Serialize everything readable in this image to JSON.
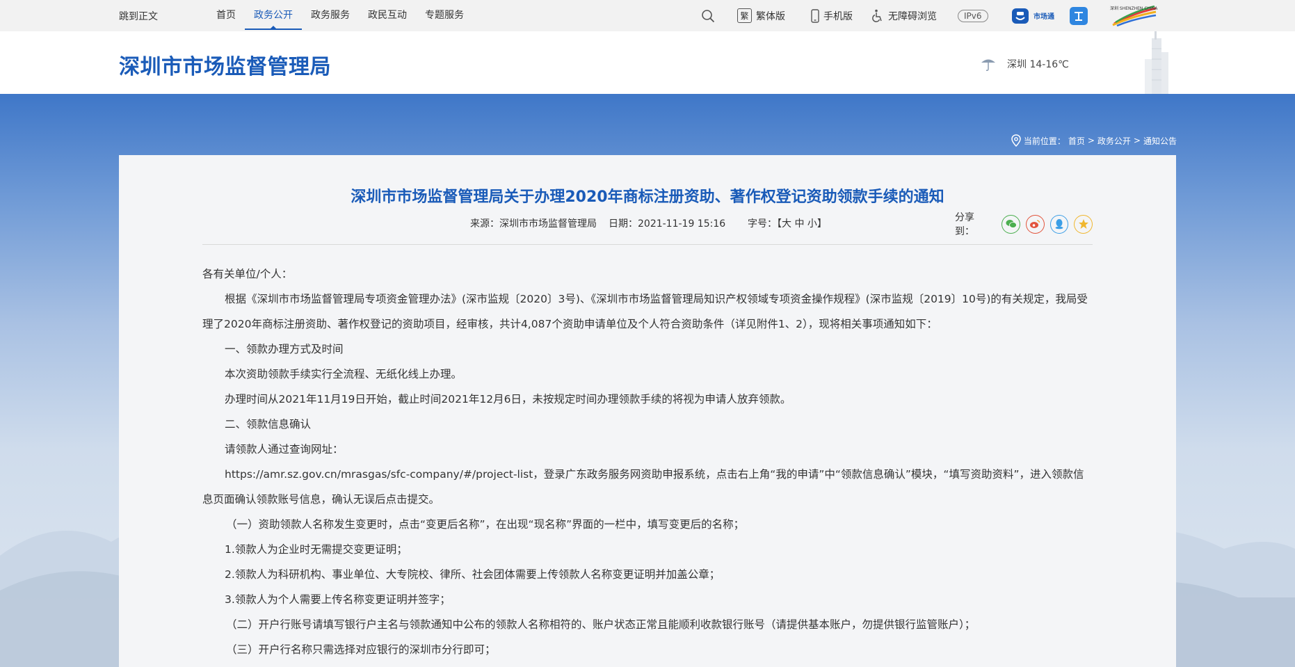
{
  "topbar": {
    "skip": "跳到正文",
    "nav": [
      "首页",
      "政务公开",
      "政务服务",
      "政民互动",
      "专题服务"
    ],
    "active_index": 1,
    "traditional": "繁体版",
    "traditional_glyph": "繁",
    "mobile": "手机版",
    "accessibility": "无障碍浏览",
    "ipv6": "IPv6",
    "shitong": "市场通",
    "shenzhen_logo": "深圳 SHENZHEN CHINA"
  },
  "header": {
    "site_title": "深圳市市场监督管理局",
    "weather": "深圳 14-16℃"
  },
  "breadcrumb": {
    "label": "当前位置：",
    "items": [
      "首页",
      "政务公开",
      "通知公告"
    ],
    "sep": ">"
  },
  "article": {
    "title": "深圳市市场监督管理局关于办理2020年商标注册资助、著作权登记资助领款手续的通知",
    "source": "来源：深圳市市场监督管理局",
    "date": "日期：2021-11-19 15:16",
    "font_size": "字号：【大  中  小】",
    "share_label": "分享到：",
    "share_icons": [
      "wechat-icon",
      "weibo-icon",
      "qq-icon",
      "qzone-icon"
    ],
    "paragraphs": [
      "各有关单位/个人：",
      "根据《深圳市市场监督管理局专项资金管理办法》(深市监规〔2020〕3号)、《深圳市市场监督管理局知识产权领域专项资金操作规程》(深市监规〔2019〕10号)的有关规定，我局受理了2020年商标注册资助、著作权登记的资助项目，经审核，共计4,087个资助申请单位及个人符合资助条件（详见附件1、2），现将相关事项通知如下：",
      "一、领款办理方式及时间",
      "本次资助领款手续实行全流程、无纸化线上办理。",
      "办理时间从2021年11月19日开始，截止时间2021年12月6日，未按规定时间办理领款手续的将视为申请人放弃领款。",
      "二、领款信息确认",
      "请领款人通过查询网址：",
      "https://amr.sz.gov.cn/mrasgas/sfc-company/#/project-list，登录广东政务服务网资助申报系统，点击右上角“我的申请”中“领款信息确认”模块，“填写资助资料”，进入领款信息页面确认领款账号信息，确认无误后点击提交。",
      "（一）资助领款人名称发生变更时，点击“变更后名称”，在出现“现名称”界面的一栏中，填写变更后的名称；",
      "1.领款人为企业时无需提交变更证明；",
      "2.领款人为科研机构、事业单位、大专院校、律所、社会团体需要上传领款人名称变更证明并加盖公章；",
      " 3.领款人为个人需要上传名称变更证明并签字；",
      "（二）开户行账号请填写银行户主名与领款通知中公布的领款人名称相符的、账户状态正常且能顺利收款银行账号（请提供基本账户，勿提供银行监管账户）；",
      "（三）开户行名称只需选择对应银行的深圳市分行即可；"
    ]
  },
  "colors": {
    "brand": "#1a5bb8",
    "wechat": "#4caf50",
    "weibo": "#e2543c",
    "qq": "#3b9ee6",
    "qzone": "#f0b72f"
  }
}
